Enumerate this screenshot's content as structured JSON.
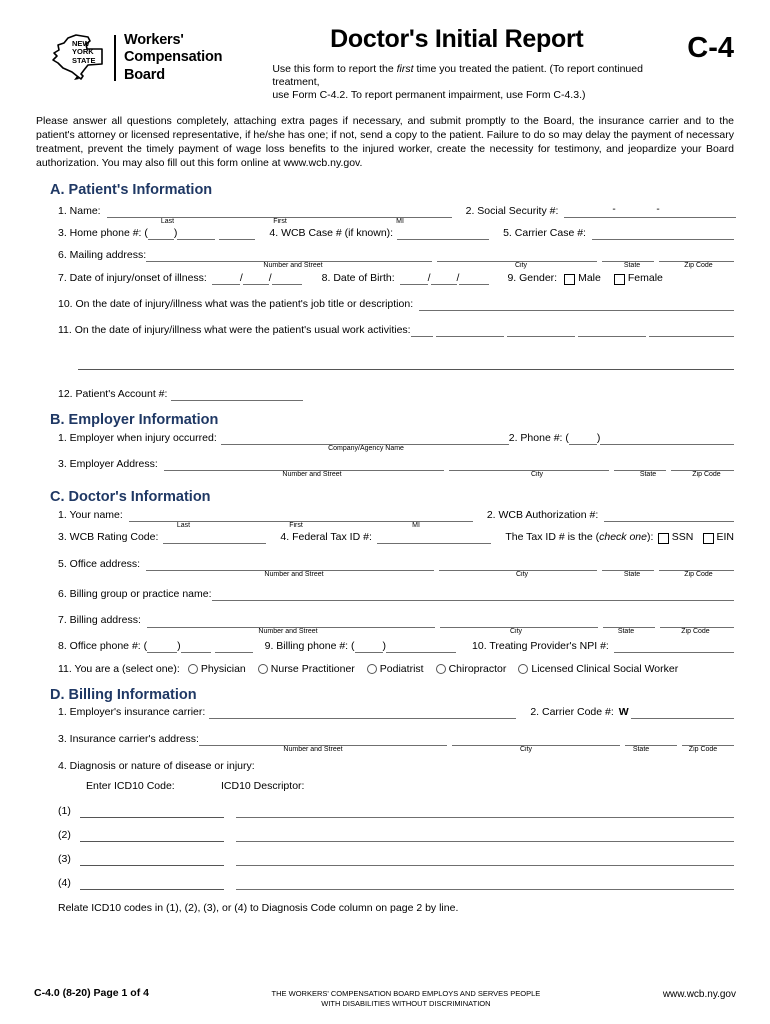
{
  "header": {
    "state_line1": "NEW",
    "state_line2": "YORK",
    "state_line3": "STATE",
    "agency_line1": "Workers'",
    "agency_line2": "Compensation",
    "agency_line3": "Board",
    "title": "Doctor's Initial Report",
    "form_code": "C-4",
    "subtitle_a": "Use this form to report the ",
    "subtitle_italic": "first",
    "subtitle_b": " time you treated the patient. (To report continued treatment,",
    "subtitle_line2": "use Form C-4.2.  To report permanent impairment, use Form C-4.3.)"
  },
  "intro": "Please answer all questions completely, attaching extra pages if necessary, and submit promptly to the Board, the insurance carrier and to the patient's attorney or licensed representative, if he/she has one; if not, send a copy to the patient. Failure to do so may delay the payment of necessary treatment, prevent the timely payment of wage loss benefits to the injured worker, create the necessity for testimony, and jeopardize your Board authorization.  You may also fill out this form online at www.wcb.ny.gov.",
  "captions": {
    "last": "Last",
    "first": "First",
    "mi": "MI",
    "number_street": "Number and Street",
    "city": "City",
    "state": "State",
    "zip": "Zip Code",
    "company_agency": "Company/Agency Name"
  },
  "sectionA": {
    "heading": "A. Patient's Information",
    "q1": "1. Name:",
    "q2": "2. Social Security #:",
    "ssn_dash": "-",
    "q3": "3. Home phone #: (",
    "q3_close": ")",
    "q4": "4. WCB Case # (if known):",
    "q5": "5. Carrier Case #:",
    "q6": "6. Mailing address:",
    "q7": "7. Date of injury/onset of illness:",
    "q8": "8. Date of Birth:",
    "q9": "9. Gender:",
    "male": "Male",
    "female": "Female",
    "q10": "10. On the date of injury/illness what was the patient's job title or description:",
    "q11": "11. On the date of injury/illness what were the patient's usual work activities:",
    "q12": "12. Patient's Account #:"
  },
  "sectionB": {
    "heading": "B. Employer Information",
    "q1": "1. Employer when injury occurred:",
    "q2": "2. Phone #: (",
    "q2_close": ")",
    "q3": "3. Employer Address:"
  },
  "sectionC": {
    "heading": "C. Doctor's Information",
    "q1": "1. Your name:",
    "q2": "2. WCB Authorization #:",
    "q3": "3. WCB Rating Code:",
    "q4": "4. Federal Tax ID #:",
    "taxid_pre": "The Tax ID # is the (",
    "taxid_italic": "check one",
    "taxid_post": "):",
    "ssn_label": "SSN",
    "ein_label": "EIN",
    "q5": "5. Office address:",
    "q6": "6. Billing group or practice name:",
    "q7": "7. Billing address:",
    "q8": "8. Office phone #: (",
    "q8_close": ")",
    "q9": "9. Billing phone #: (",
    "q9_close": ")",
    "q10": "10. Treating Provider's NPI #:",
    "q11": "11. You are a (select one):",
    "options": [
      "Physician",
      "Nurse Practitioner",
      "Podiatrist",
      "Chiropractor",
      "Licensed Clinical Social Worker"
    ]
  },
  "sectionD": {
    "heading": "D. Billing Information",
    "q1": "1. Employer's insurance carrier:",
    "q2": "2. Carrier Code #:",
    "q2_prefix": "W",
    "q3": "3. Insurance carrier's address:",
    "q4": "4. Diagnosis or nature of disease or injury:",
    "icd_code_header": "Enter ICD10 Code:",
    "icd_desc_header": "ICD10 Descriptor:",
    "rows": [
      "(1)",
      "(2)",
      "(3)",
      "(4)"
    ],
    "relate_note": "Relate ICD10 codes in (1), (2), (3), or (4) to Diagnosis Code column on page 2 by line."
  },
  "footer": {
    "left": "C-4.0 (8-20)  Page 1 of 4",
    "center_line1": "THE WORKERS' COMPENSATION BOARD EMPLOYS AND SERVES PEOPLE",
    "center_line2": "WITH DISABILITIES WITHOUT DISCRIMINATION",
    "right": "www.wcb.ny.gov"
  },
  "colors": {
    "heading_blue": "#1F3864",
    "rule": "#6f6f6f"
  }
}
